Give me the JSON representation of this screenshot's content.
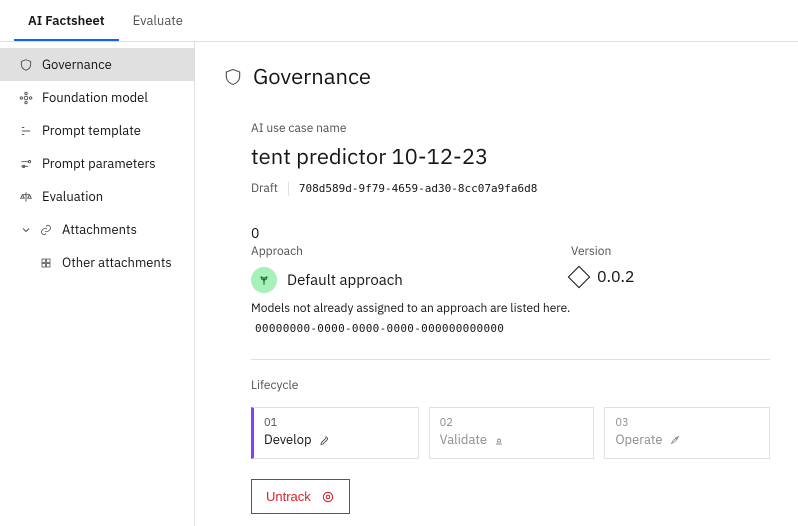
{
  "tabs": {
    "ai_factsheet": "AI Factsheet",
    "evaluate": "Evaluate"
  },
  "sidebar": {
    "governance": "Governance",
    "foundation_model": "Foundation model",
    "prompt_template": "Prompt template",
    "prompt_parameters": "Prompt parameters",
    "evaluation": "Evaluation",
    "attachments": "Attachments",
    "other_attachments": "Other attachments"
  },
  "main": {
    "title": "Governance",
    "usecase_label": "AI use case name",
    "usecase_name": "tent predictor 10-12-23",
    "status": "Draft",
    "usecase_id": "708d589d-9f79-4659-ad30-8cc07a9fa6d8",
    "zero": "0",
    "approach_label": "Approach",
    "approach_name": "Default approach",
    "approach_note": "Models not already assigned to an approach are listed here.",
    "approach_id": "00000000-0000-0000-0000-000000000000",
    "version_label": "Version",
    "version_value": "0.0.2",
    "lifecycle_label": "Lifecycle",
    "stages": {
      "s1_num": "01",
      "s1_name": "Develop",
      "s2_num": "02",
      "s2_name": "Validate",
      "s3_num": "03",
      "s3_name": "Operate"
    },
    "untrack": "Untrack"
  }
}
